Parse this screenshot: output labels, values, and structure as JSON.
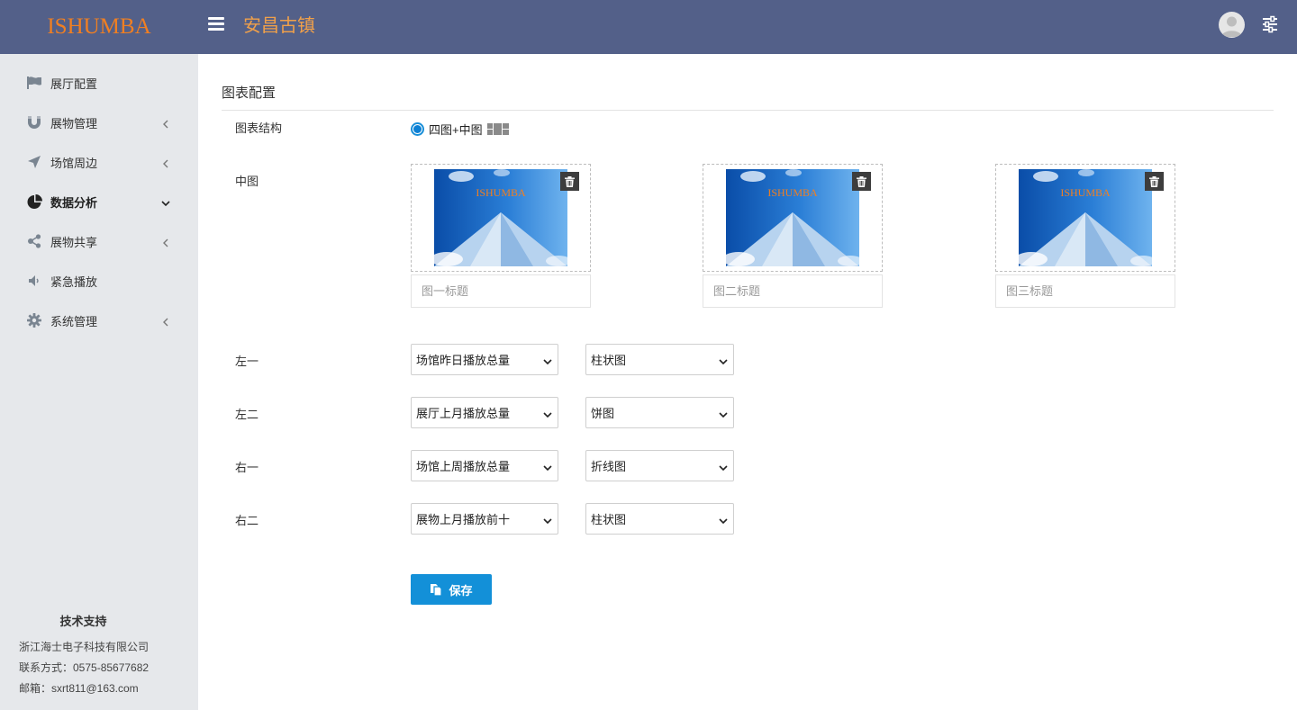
{
  "header": {
    "logo": "ISHUMBA",
    "site_title": "安昌古镇",
    "colors": {
      "bar": "#536089",
      "logo": "#f07f22",
      "title": "#f0a04a"
    }
  },
  "sidebar": {
    "items": [
      {
        "label": "展厅配置",
        "icon": "flag-icon",
        "arrow": "none",
        "active": false
      },
      {
        "label": "展物管理",
        "icon": "magnet-icon",
        "arrow": "left",
        "active": false
      },
      {
        "label": "场馆周边",
        "icon": "location-arrow-icon",
        "arrow": "left",
        "active": false
      },
      {
        "label": "数据分析",
        "icon": "pie-chart-icon",
        "arrow": "down",
        "active": true
      },
      {
        "label": "展物共享",
        "icon": "share-icon",
        "arrow": "left",
        "active": false
      },
      {
        "label": "紧急播放",
        "icon": "volume-icon",
        "arrow": "none",
        "active": false
      },
      {
        "label": "系统管理",
        "icon": "gear-icon",
        "arrow": "left",
        "active": false
      }
    ],
    "support": {
      "title": "技术支持",
      "company": "浙江海士电子科技有限公司",
      "contact": "联系方式：0575-85677682",
      "email": "邮箱：sxrt811@163.com"
    }
  },
  "main": {
    "section_title": "图表配置",
    "structure": {
      "label": "图表结构",
      "option": "四图+中图",
      "checked": true
    },
    "center": {
      "label": "中图",
      "images": [
        {
          "logo_text": "ISHUMBA",
          "placeholder": "图一标题",
          "value": ""
        },
        {
          "logo_text": "ISHUMBA",
          "placeholder": "图二标题",
          "value": ""
        },
        {
          "logo_text": "ISHUMBA",
          "placeholder": "图三标题",
          "value": ""
        }
      ]
    },
    "rows": [
      {
        "label": "左一",
        "data_source": "场馆昨日播放总量",
        "chart_type": "柱状图"
      },
      {
        "label": "左二",
        "data_source": "展厅上月播放总量",
        "chart_type": "饼图"
      },
      {
        "label": "右一",
        "data_source": "场馆上周播放总量",
        "chart_type": "折线图"
      },
      {
        "label": "右二",
        "data_source": "展物上月播放前十",
        "chart_type": "柱状图"
      }
    ],
    "save_label": "保存",
    "accent": "#1390d8"
  }
}
